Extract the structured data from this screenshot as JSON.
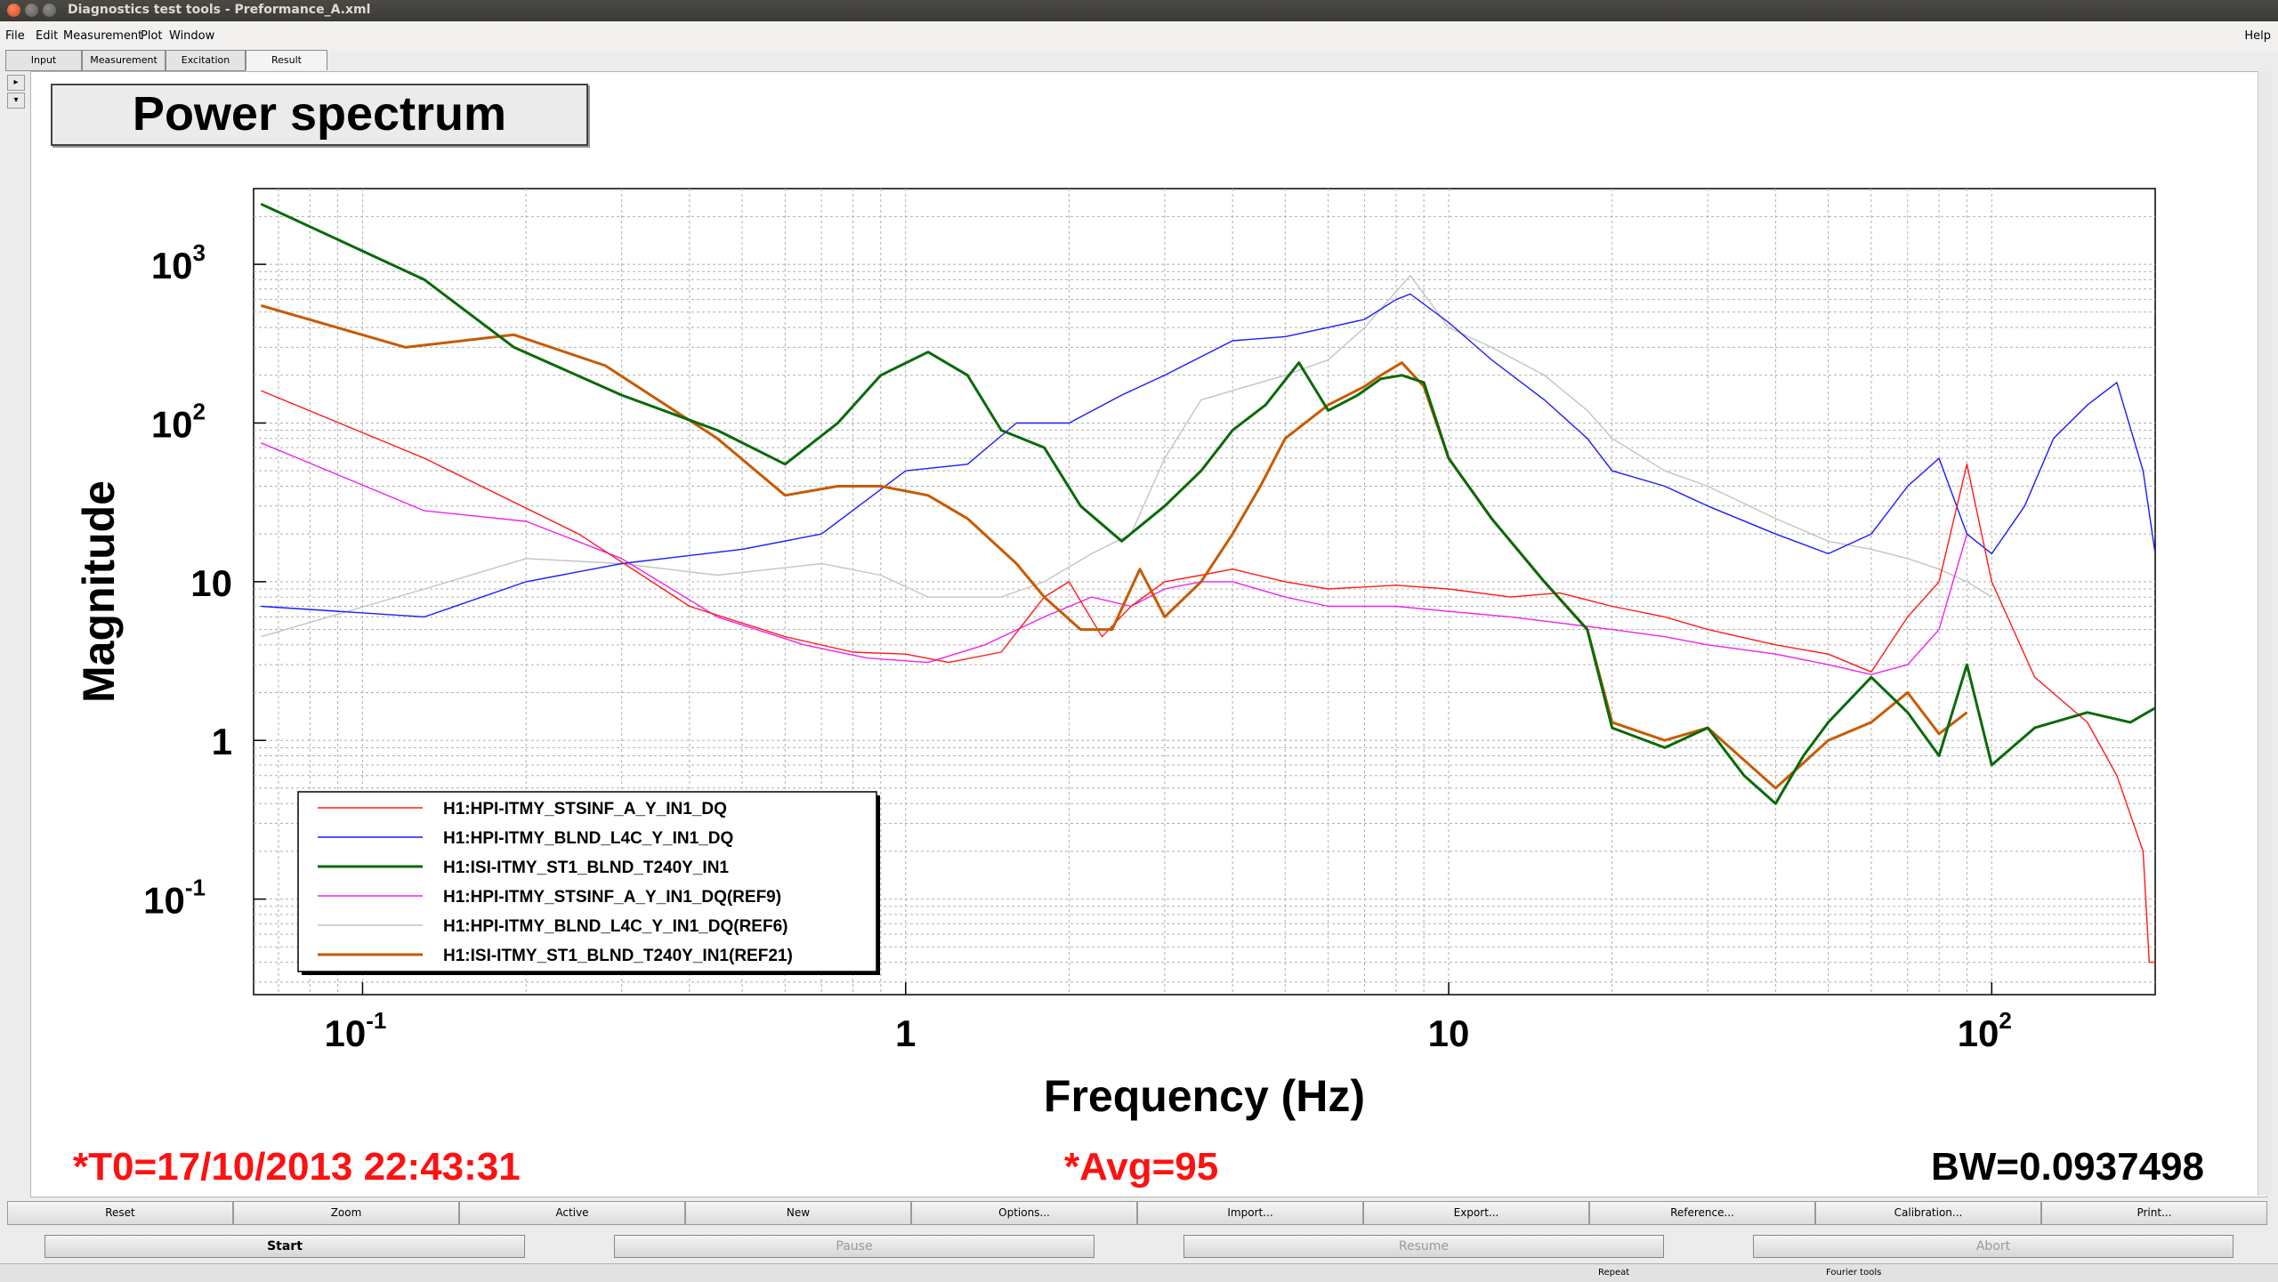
{
  "window": {
    "title": "Diagnostics test tools - Preformance_A.xml"
  },
  "menu": {
    "items": [
      "File",
      "Edit",
      "Measurement",
      "Plot",
      "Window"
    ],
    "help": "Help"
  },
  "tabs": [
    {
      "label": "Input"
    },
    {
      "label": "Measurement"
    },
    {
      "label": "Excitation"
    },
    {
      "label": "Result",
      "selected": true
    }
  ],
  "plot": {
    "title": "Power spectrum",
    "t0": "*T0=17/10/2013 22:43:31",
    "avg": "*Avg=95",
    "bw": "BW=0.0937498",
    "colors": {
      "t0": "#ff1010",
      "avg": "#ff1010",
      "bw": "#000000"
    }
  },
  "chart_data": {
    "type": "line",
    "title": "",
    "xlabel": "Frequency (Hz)",
    "ylabel": "Magnitude",
    "xscale": "log",
    "yscale": "log",
    "xlim": [
      0.063,
      200
    ],
    "ylim": [
      0.025,
      3000
    ],
    "grid": true,
    "legend_position": "bottom-left",
    "x_ticks": [
      {
        "value": 0.1,
        "base": "10",
        "exp": "-1"
      },
      {
        "value": 1,
        "base": "1",
        "exp": ""
      },
      {
        "value": 10,
        "base": "10",
        "exp": ""
      },
      {
        "value": 100,
        "base": "10",
        "exp": "2"
      }
    ],
    "y_ticks": [
      {
        "value": 1000,
        "base": "10",
        "exp": "3"
      },
      {
        "value": 100,
        "base": "10",
        "exp": "2"
      },
      {
        "value": 10,
        "base": "10",
        "exp": ""
      },
      {
        "value": 1,
        "base": "1",
        "exp": ""
      },
      {
        "value": 0.1,
        "base": "10",
        "exp": "-1"
      }
    ],
    "series": [
      {
        "name": "H1:HPI-ITMY_STSINF_A_Y_IN1_DQ",
        "color": "#ff1a1a",
        "width": 1.4,
        "x": [
          0.065,
          0.13,
          0.25,
          0.4,
          0.6,
          0.8,
          1,
          1.2,
          1.5,
          1.8,
          2,
          2.3,
          2.6,
          3,
          3.5,
          4,
          5,
          6,
          8,
          10,
          13,
          16,
          20,
          25,
          30,
          40,
          50,
          60,
          70,
          80,
          90,
          100,
          120,
          150,
          170,
          190,
          195,
          200
        ],
        "y": [
          160,
          60,
          20,
          7,
          4.5,
          3.6,
          3.5,
          3.1,
          3.6,
          8,
          10,
          4.5,
          7,
          10,
          11,
          12,
          10,
          9,
          9.5,
          9,
          8,
          8.5,
          7,
          6,
          5,
          4,
          3.5,
          2.7,
          6,
          10,
          55,
          10,
          2.5,
          1.3,
          0.6,
          0.2,
          0.04,
          0.04
        ]
      },
      {
        "name": "H1:HPI-ITMY_BLND_L4C_Y_IN1_DQ",
        "color": "#1a1aff",
        "width": 1.4,
        "x": [
          0.065,
          0.13,
          0.2,
          0.3,
          0.5,
          0.7,
          1,
          1.3,
          1.6,
          2,
          2.5,
          3,
          4,
          5,
          6,
          7,
          8,
          8.5,
          10,
          12,
          15,
          18,
          20,
          25,
          30,
          40,
          50,
          60,
          70,
          80,
          90,
          100,
          115,
          130,
          150,
          170,
          190,
          200
        ],
        "y": [
          7,
          6,
          10,
          13,
          16,
          20,
          50,
          55,
          100,
          100,
          150,
          200,
          330,
          350,
          400,
          450,
          600,
          650,
          430,
          250,
          140,
          80,
          50,
          40,
          30,
          20,
          15,
          20,
          40,
          60,
          20,
          15,
          30,
          80,
          130,
          180,
          50,
          15
        ]
      },
      {
        "name": "H1:ISI-ITMY_ST1_BLND_T240Y_IN1",
        "color": "#0a6a0a",
        "width": 3,
        "x": [
          0.065,
          0.13,
          0.19,
          0.3,
          0.45,
          0.6,
          0.75,
          0.9,
          1.1,
          1.3,
          1.5,
          1.8,
          2.1,
          2.5,
          3,
          3.5,
          4,
          4.6,
          5.3,
          6,
          6.8,
          7.5,
          8.2,
          9,
          10,
          12,
          15,
          18,
          20,
          25,
          30,
          35,
          40,
          45,
          50,
          60,
          70,
          80,
          90,
          100,
          120,
          150,
          180,
          200
        ],
        "y": [
          2400,
          800,
          300,
          150,
          90,
          55,
          100,
          200,
          280,
          200,
          90,
          70,
          30,
          18,
          30,
          50,
          90,
          130,
          240,
          120,
          150,
          190,
          200,
          180,
          60,
          25,
          10,
          5,
          1.2,
          0.9,
          1.2,
          0.6,
          0.4,
          0.8,
          1.3,
          2.5,
          1.5,
          0.8,
          3,
          0.7,
          1.2,
          1.5,
          1.3,
          1.6
        ]
      },
      {
        "name": "H1:HPI-ITMY_STSINF_A_Y_IN1_DQ(REF9)",
        "color": "#ee22ee",
        "width": 1.4,
        "x": [
          0.065,
          0.13,
          0.2,
          0.3,
          0.45,
          0.65,
          0.85,
          1.1,
          1.4,
          1.8,
          2.2,
          2.6,
          3,
          3.5,
          4,
          5,
          6,
          8,
          10,
          13,
          16,
          20,
          25,
          30,
          40,
          50,
          60,
          70,
          80,
          90
        ],
        "y": [
          75,
          28,
          24,
          14,
          6,
          4,
          3.3,
          3.1,
          4,
          6,
          8,
          7,
          9,
          10,
          10,
          8,
          7,
          7,
          6.5,
          6,
          5.5,
          5,
          4.5,
          4,
          3.5,
          3,
          2.6,
          3,
          5,
          20
        ]
      },
      {
        "name": "H1:HPI-ITMY_BLND_L4C_Y_IN1_DQ(REF6)",
        "color": "#c4c4c4",
        "width": 1.4,
        "x": [
          0.065,
          0.13,
          0.2,
          0.3,
          0.45,
          0.7,
          0.9,
          1.1,
          1.5,
          1.8,
          2.2,
          2.6,
          3,
          3.5,
          4,
          5,
          6,
          7,
          8.5,
          10,
          12,
          15,
          18,
          20,
          25,
          30,
          40,
          50,
          60,
          70,
          80,
          90,
          100
        ],
        "y": [
          4.5,
          9,
          14,
          13,
          11,
          13,
          11,
          8,
          8,
          10,
          15,
          20,
          60,
          140,
          160,
          200,
          250,
          400,
          850,
          400,
          300,
          200,
          120,
          80,
          50,
          40,
          25,
          18,
          16,
          14,
          12,
          10,
          8
        ]
      },
      {
        "name": "H1:ISI-ITMY_ST1_BLND_T240Y_IN1(REF21)",
        "color": "#c85a00",
        "width": 3,
        "x": [
          0.065,
          0.12,
          0.19,
          0.28,
          0.45,
          0.6,
          0.75,
          0.9,
          1.1,
          1.3,
          1.6,
          1.8,
          2.1,
          2.4,
          2.7,
          3,
          3.5,
          4,
          4.5,
          5,
          6,
          7,
          7.5,
          8.2,
          9,
          10,
          12,
          15,
          18,
          20,
          25,
          30,
          40,
          50,
          60,
          70,
          80,
          90
        ],
        "y": [
          550,
          300,
          360,
          230,
          80,
          35,
          40,
          40,
          35,
          25,
          13,
          8,
          5,
          5,
          12,
          6,
          10,
          20,
          40,
          80,
          130,
          170,
          200,
          240,
          170,
          60,
          25,
          10,
          5,
          1.3,
          1,
          1.2,
          0.5,
          1,
          1.3,
          2,
          1.1,
          1.5
        ]
      }
    ]
  },
  "toolbar": {
    "buttons": [
      "Reset",
      "Zoom",
      "Active",
      "New",
      "Options...",
      "Import...",
      "Export...",
      "Reference...",
      "Calibration...",
      "Print..."
    ]
  },
  "controls": {
    "start": "Start",
    "pause": "Pause",
    "resume": "Resume",
    "abort": "Abort"
  },
  "statusbar": {
    "repeat": "Repeat",
    "fourier": "Fourier tools"
  }
}
